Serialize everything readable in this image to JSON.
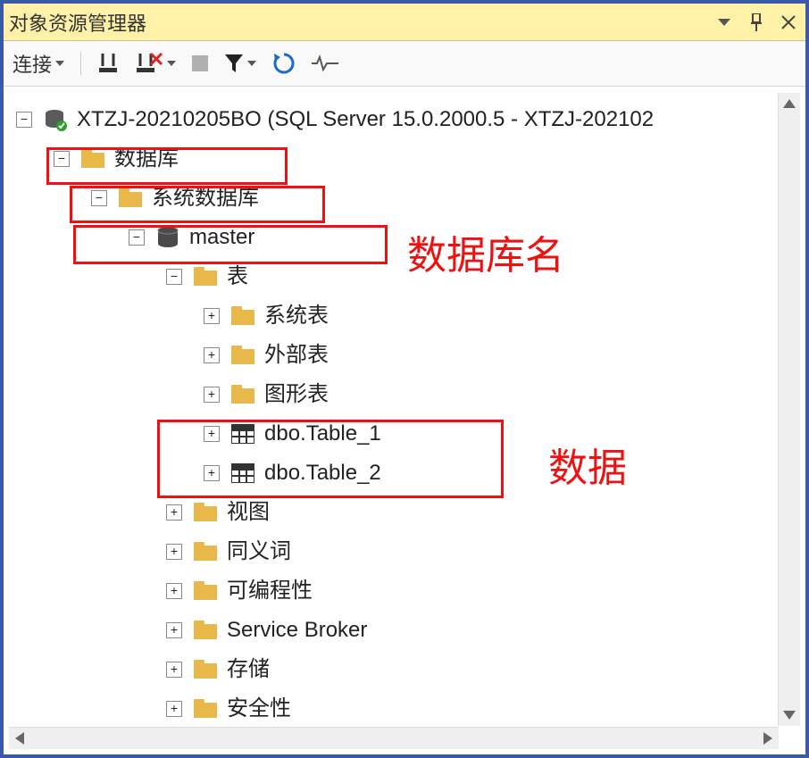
{
  "titlebar": {
    "title": "对象资源管理器"
  },
  "toolbar": {
    "connect_label": "连接"
  },
  "tree": {
    "server": "XTZJ-20210205BO (SQL Server 15.0.2000.5 - XTZJ-202102",
    "databases": "数据库",
    "system_databases": "系统数据库",
    "master": "master",
    "tables": "表",
    "system_tables": "系统表",
    "external_tables": "外部表",
    "graph_tables": "图形表",
    "table1": "dbo.Table_1",
    "table2": "dbo.Table_2",
    "views": "视图",
    "synonyms": "同义词",
    "programmability": "可编程性",
    "service_broker": "Service Broker",
    "storage": "存储",
    "security": "安全性"
  },
  "annotations": {
    "db_name": "数据库名",
    "data": "数据"
  }
}
